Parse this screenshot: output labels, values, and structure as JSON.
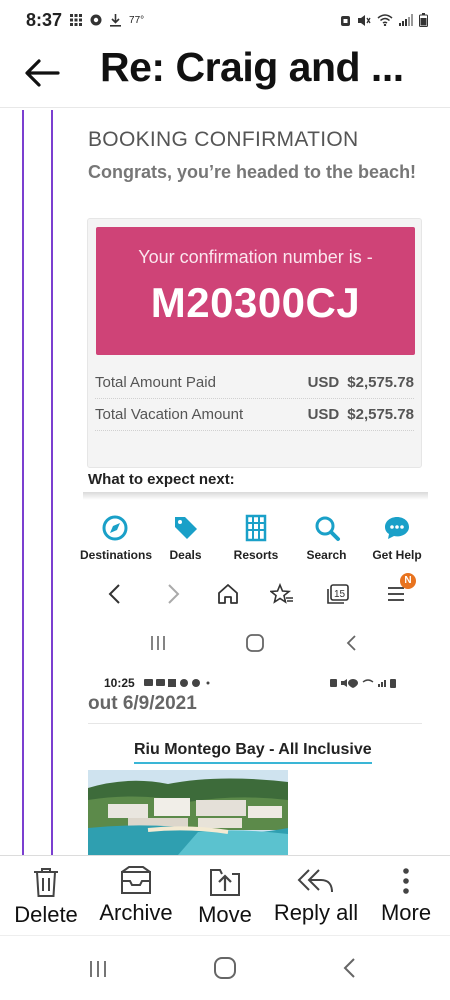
{
  "status_bar": {
    "time": "8:37",
    "temperature": "77°"
  },
  "header": {
    "subject": "Re: Craig and ..."
  },
  "email": {
    "booking_title": "BOOKING CONFIRMATION",
    "booking_subtitle": "Congrats, you’re headed to the beach!",
    "confirmation_label": "Your confirmation number is -",
    "confirmation_number": "M20300CJ",
    "amounts": [
      {
        "label": "Total Amount Paid",
        "currency": "USD",
        "value": "$2,575.78"
      },
      {
        "label": "Total Vacation Amount",
        "currency": "USD",
        "value": "$2,575.78"
      }
    ],
    "what_next": "What to expect next:",
    "site_nav": [
      "Destinations",
      "Deals",
      "Resorts",
      "Search",
      "Get Help"
    ],
    "tabs_count": "15",
    "notification_badge": "N",
    "inner_status_time": "10:25",
    "out_date": "out 6/9/2021",
    "resort_name": "Riu Montego Bay - All Inclusive"
  },
  "actions": [
    {
      "label": "Delete",
      "icon": "trash-icon"
    },
    {
      "label": "Archive",
      "icon": "archive-icon"
    },
    {
      "label": "Move",
      "icon": "move-icon"
    },
    {
      "label": "Reply all",
      "icon": "reply-all-icon"
    },
    {
      "label": "More",
      "icon": "more-vertical-icon"
    }
  ],
  "colors": {
    "confirmation_box": "#cf4377",
    "site_nav_icons": "#1aa0c8",
    "quote_line": "#7b3fd0",
    "badge": "#e8731f"
  }
}
